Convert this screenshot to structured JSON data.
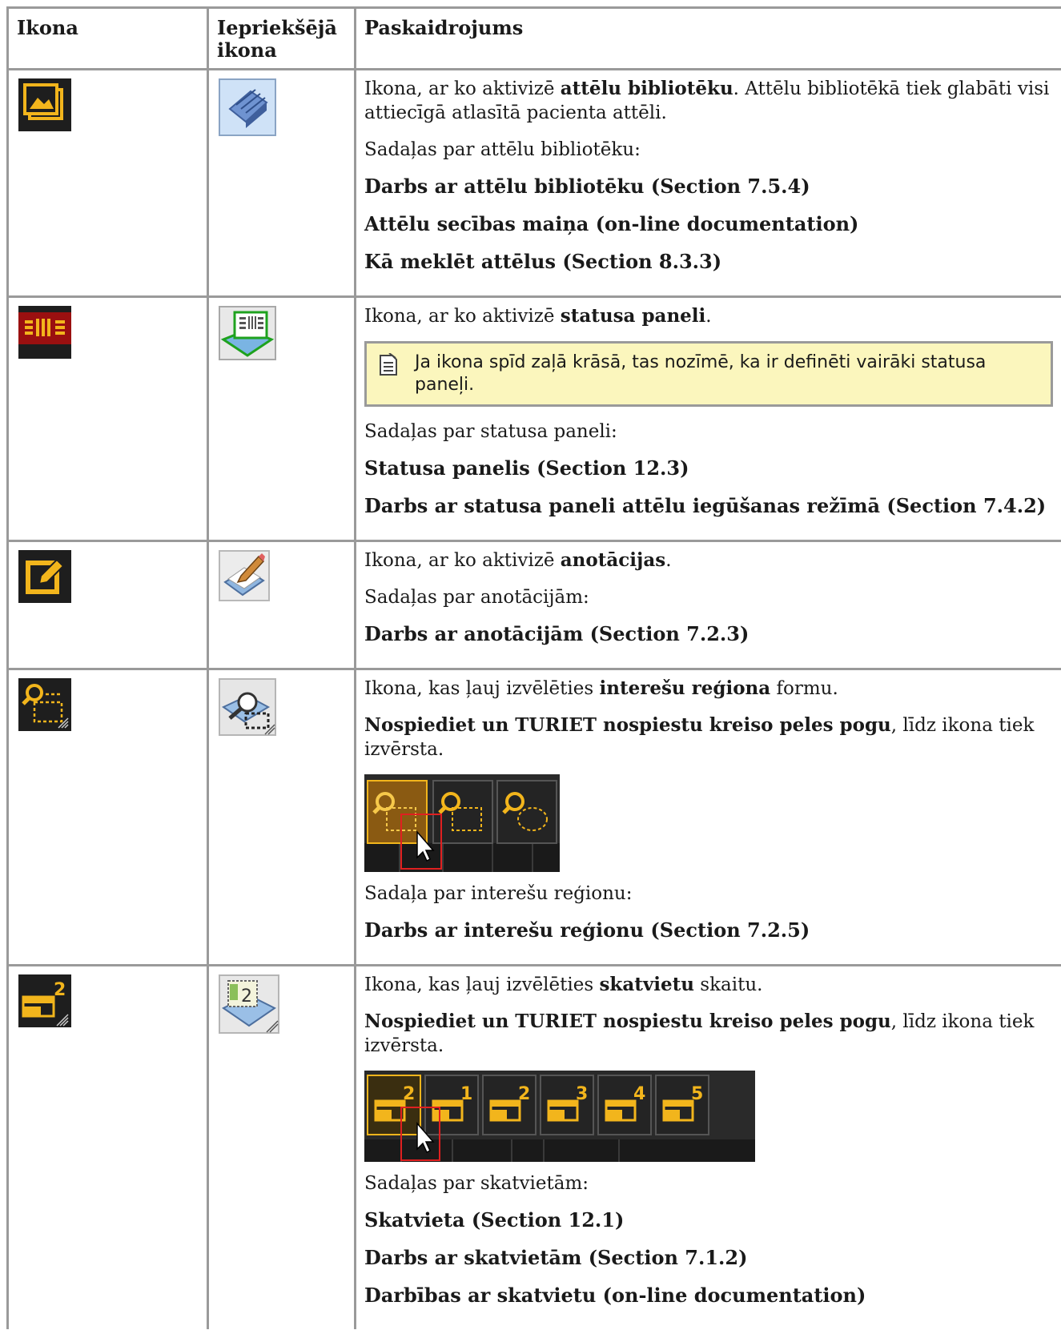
{
  "table": {
    "headers": {
      "icon": "Ikona",
      "prev": "Iepriekšējā ikona",
      "desc": "Paskaidrojums"
    }
  },
  "rows": [
    {
      "intro": {
        "pre": "Ikona, ar ko aktivizē ",
        "bold": "attēlu bibliotēku",
        "post": ". Attēlu bibliotēkā tiek glabāti visi attiecīgā atlasītā pacienta attēli."
      },
      "sections_label": "Sadaļas par attēlu bibliotēku:",
      "links": [
        "Darbs ar attēlu bibliotēku (Section 7.5.4)",
        "Attēlu secības maiņa (on-line documentation)",
        "Kā meklēt attēlus (Section 8.3.3)"
      ]
    },
    {
      "intro": {
        "pre": "Ikona, ar ko aktivizē ",
        "bold": "statusa paneli",
        "post": "."
      },
      "note": "Ja ikona spīd zaļā krāsā, tas nozīmē, ka ir definēti vairāki statusa paneļi.",
      "sections_label": "Sadaļas par statusa paneli:",
      "links": [
        "Statusa panelis (Section 12.3)",
        "Darbs ar statusa paneli attēlu iegūšanas režīmā (Section 7.4.2)"
      ]
    },
    {
      "intro": {
        "pre": "Ikona, ar ko aktivizē ",
        "bold": "anotācijas",
        "post": "."
      },
      "sections_label": "Sadaļas par anotācijām:",
      "links": [
        "Darbs ar anotācijām (Section 7.2.3)"
      ]
    },
    {
      "intro": {
        "pre": "Ikona, kas ļauj izvēlēties ",
        "bold": "interešu reģiona",
        "post": " formu."
      },
      "instruction": {
        "bold": "Nospiediet un TURIET nospiestu kreiso peles pogu",
        "post": ", līdz ikona tiek izvērsta."
      },
      "sections_label": "Sadaļa par interešu reģionu:",
      "links": [
        "Darbs ar interešu reģionu (Section 7.2.5)"
      ]
    },
    {
      "intro": {
        "pre": "Ikona, kas ļauj izvēlēties ",
        "bold": "skatvietu",
        "post": " skaitu."
      },
      "instruction": {
        "bold": "Nospiediet un TURIET nospiestu kreiso peles pogu",
        "post": ", līdz ikona tiek izvērsta."
      },
      "viewport_numbers": [
        "2",
        "1",
        "2",
        "3",
        "4",
        "5"
      ],
      "sections_label": "Sadaļas par skatvietām:",
      "links": [
        "Skatvieta (Section 12.1)",
        "Darbs ar skatvietām (Section 7.1.2)",
        "Darbības ar skatvietu (on-line documentation)"
      ]
    }
  ],
  "icons": {
    "row0": [
      "image-library-icon",
      "old-image-library-icon"
    ],
    "row1": [
      "status-panel-icon",
      "old-status-panel-icon"
    ],
    "row2": [
      "annotation-icon",
      "old-annotation-icon"
    ],
    "row3": [
      "region-of-interest-icon",
      "old-region-of-interest-icon"
    ],
    "row4": [
      "viewport-count-icon",
      "old-viewport-count-icon"
    ],
    "note_icon": "note-icon"
  },
  "colors": {
    "accent_yellow": "#f2b51c",
    "icon_bg": "#1e1e1e",
    "note_bg": "#fbf6bd",
    "border": "#9a9a9a"
  }
}
